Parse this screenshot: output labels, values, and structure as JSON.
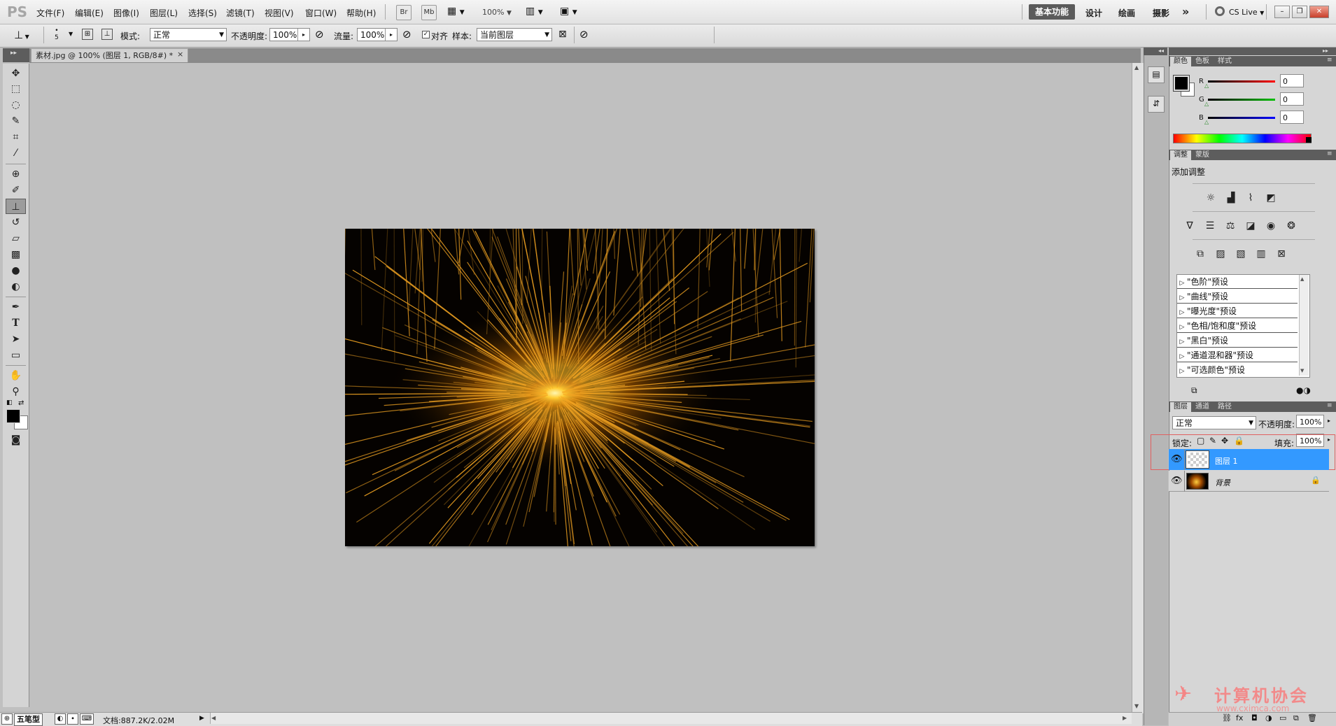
{
  "menu": {
    "logo": "PS",
    "items": [
      "文件(F)",
      "编辑(E)",
      "图像(I)",
      "图层(L)",
      "选择(S)",
      "滤镜(T)",
      "视图(V)",
      "窗口(W)",
      "帮助(H)"
    ],
    "br_label": "Br",
    "mb_label": "Mb",
    "zoom": "100%"
  },
  "workspaces": {
    "active": "基本功能",
    "others": [
      "设计",
      "绘画",
      "摄影"
    ],
    "more": "»",
    "cslive": "CS Live"
  },
  "options": {
    "brush_size": "5",
    "mode_label": "模式:",
    "mode_value": "正常",
    "opacity_label": "不透明度:",
    "opacity_value": "100%",
    "flow_label": "流量:",
    "flow_value": "100%",
    "aligned_label": "对齐",
    "aligned_checked": true,
    "sample_label": "样本:",
    "sample_value": "当前图层"
  },
  "document": {
    "tab_title": "素材.jpg @ 100% (图层 1, RGB/8#) *",
    "close": "×"
  },
  "status": {
    "ime_label": "五笔型",
    "doc_info": "文档:887.2K/2.02M"
  },
  "colorPanel": {
    "tabs": [
      "颜色",
      "色板",
      "样式"
    ],
    "channels": [
      {
        "label": "R",
        "value": "0",
        "color": "#ff0000"
      },
      {
        "label": "G",
        "value": "0",
        "color": "#00c000"
      },
      {
        "label": "B",
        "value": "0",
        "color": "#0000ff"
      }
    ],
    "foreground": "#000000",
    "background": "#ffffff"
  },
  "adjustPanel": {
    "tabs": [
      "调整",
      "蒙版"
    ],
    "title": "添加调整",
    "presets": [
      "\"色阶\"预设",
      "\"曲线\"预设",
      "\"曝光度\"预设",
      "\"色相/饱和度\"预设",
      "\"黑白\"预设",
      "\"通道混和器\"预设",
      "\"可选颜色\"预设"
    ]
  },
  "layersPanel": {
    "tabs": [
      "图层",
      "通道",
      "路径"
    ],
    "blend_mode": "正常",
    "opacity_label": "不透明度:",
    "opacity_value": "100%",
    "lock_label": "锁定:",
    "fill_label": "填充:",
    "fill_value": "100%",
    "layers": [
      {
        "name": "图层 1",
        "selected": true,
        "visible": true
      },
      {
        "name": "背景",
        "selected": false,
        "visible": true,
        "locked": true
      }
    ]
  },
  "watermark": {
    "title": "计算机协会",
    "url": "www.cximca.com"
  },
  "colors": {
    "selection": "#3399ff",
    "panel_header": "#5d5d5d",
    "canvas_bg": "#c0c0c0",
    "highlight_box": "#e06060"
  }
}
